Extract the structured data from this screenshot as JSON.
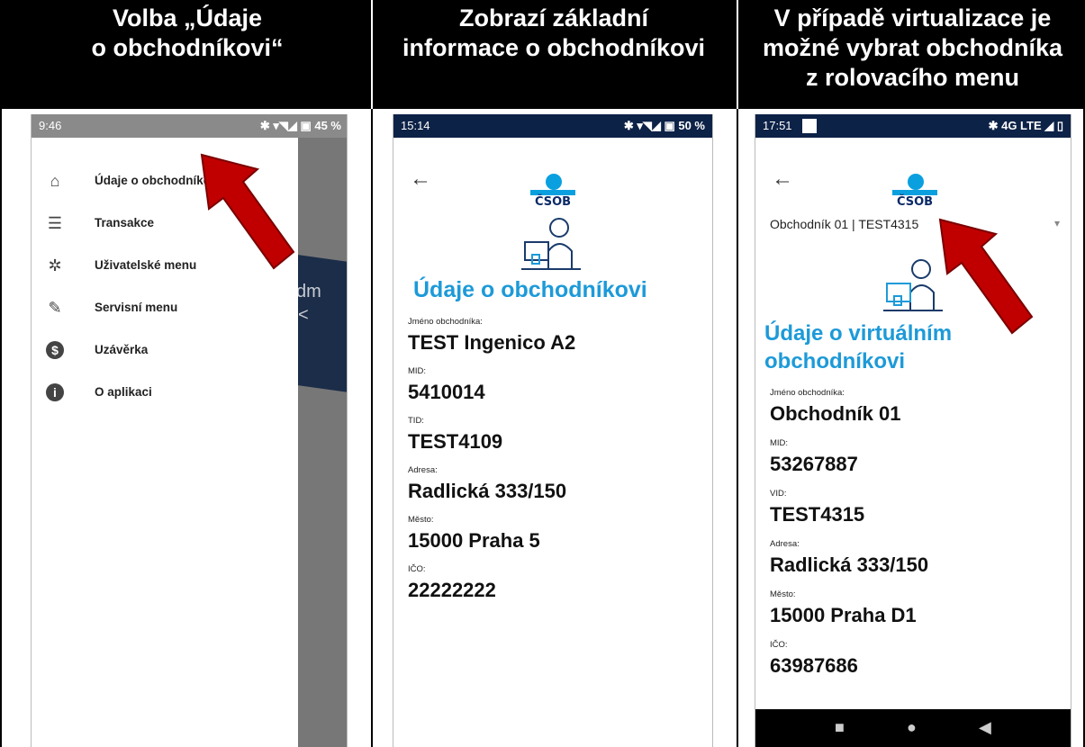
{
  "headers": [
    "Volba „Údaje\no obchodníkovi“",
    "Zobrazí základní\ninformace o obchodníkovi",
    "V případě virtualizace je\nmožné vybrat obchodníka\nz rolovacího menu"
  ],
  "p1": {
    "time": "9:46",
    "status": "✱ ▾◥◢ ▣ 45 %",
    "menu": [
      {
        "label": "Údaje o obchodníkovi",
        "icon": "merchant-icon"
      },
      {
        "label": "Transakce",
        "icon": "list-icon"
      },
      {
        "label": "Uživatelské menu",
        "icon": "gear-icon"
      },
      {
        "label": "Servisní menu",
        "icon": "wrench-icon"
      },
      {
        "label": "Uzávěrka",
        "icon": "dollar-circle-icon"
      },
      {
        "label": "O aplikaci",
        "icon": "info-icon"
      }
    ],
    "bg_text": "dm",
    "bg_chev": "<"
  },
  "p2": {
    "time": "15:14",
    "status": "✱ ▾◥◢ ▣ 50 %",
    "back": "←",
    "logo": "ČSOB",
    "title": "Údaje o obchodníkovi",
    "fields": [
      {
        "label": "Jméno obchodníka:",
        "value": "TEST Ingenico A2"
      },
      {
        "label": "MID:",
        "value": "5410014"
      },
      {
        "label": "TID:",
        "value": "TEST4109"
      },
      {
        "label": "Adresa:",
        "value": "Radlická 333/150"
      },
      {
        "label": "Město:",
        "value": "15000 Praha 5"
      },
      {
        "label": "IČO:",
        "value": "22222222"
      }
    ]
  },
  "p3": {
    "time": "17:51",
    "status": "✱ 4G LTE ◢ ▯",
    "back": "←",
    "logo": "ČSOB",
    "dropdown": "Obchodník 01 | TEST4315",
    "dropdown_chev": "▾",
    "title1": "Údaje o virtuálním",
    "title2": "obchodníkovi",
    "fields": [
      {
        "label": "Jméno obchodníka:",
        "value": "Obchodník 01"
      },
      {
        "label": "MID:",
        "value": "53267887"
      },
      {
        "label": "VID:",
        "value": "TEST4315"
      },
      {
        "label": "Adresa:",
        "value": "Radlická 333/150"
      },
      {
        "label": "Město:",
        "value": "15000 Praha D1"
      },
      {
        "label": "IČO:",
        "value": "63987686"
      }
    ],
    "nav": [
      "■",
      "●",
      "◀"
    ]
  },
  "colors": {
    "accent": "#1d9ad8",
    "arrow": "#c00000",
    "navy": "#0a2a66"
  }
}
